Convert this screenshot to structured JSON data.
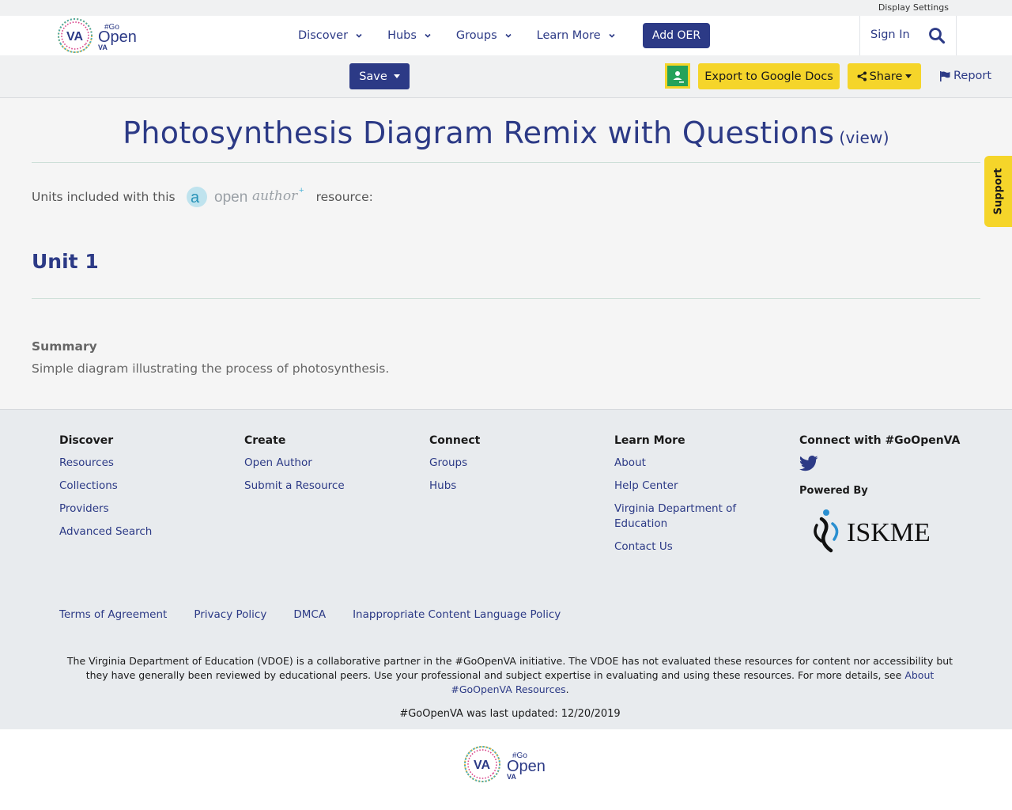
{
  "utility": {
    "display_settings": "Display Settings"
  },
  "header": {
    "logo_alt": "#GoOpenVA",
    "logo_text": {
      "va": "VA",
      "go": "#Go",
      "open": "Open",
      "va_small": "VA"
    },
    "nav": [
      {
        "label": "Discover"
      },
      {
        "label": "Hubs"
      },
      {
        "label": "Groups"
      },
      {
        "label": "Learn More"
      }
    ],
    "add_oer": "Add OER",
    "sign_in": "Sign In"
  },
  "toolbar": {
    "save": "Save",
    "export": "Export to Google Docs",
    "share": "Share",
    "report": "Report"
  },
  "main": {
    "title": "Photosynthesis Diagram Remix with Questions",
    "view_link": "(view)",
    "units_prefix": "Units included with this",
    "units_suffix": "resource:",
    "openauthor_logo": {
      "open": "open",
      "author": "author"
    },
    "unit_title": "Unit 1",
    "summary_heading": "Summary",
    "summary_text": "Simple diagram illustrating the process of photosynthesis."
  },
  "support_tab": "Support",
  "footer": {
    "columns": [
      {
        "heading": "Discover",
        "links": [
          "Resources",
          "Collections",
          "Providers",
          "Advanced Search"
        ]
      },
      {
        "heading": "Create",
        "links": [
          "Open Author",
          "Submit a Resource"
        ]
      },
      {
        "heading": "Connect",
        "links": [
          "Groups",
          "Hubs"
        ]
      },
      {
        "heading": "Learn More",
        "links": [
          "About",
          "Help Center",
          "Virginia Department of Education",
          "Contact Us"
        ]
      }
    ],
    "connect_heading": "Connect with #GoOpenVA",
    "powered_by": "Powered By",
    "iskme_text": "ISKME",
    "legal_links": [
      "Terms of Agreement",
      "Privacy Policy",
      "DMCA",
      "Inappropriate Content Language Policy"
    ],
    "disclaimer": "The Virginia Department of Education (VDOE) is a collaborative partner in the #GoOpenVA initiative. The VDOE has not evaluated these resources for content nor accessibility but they have generally been reviewed by educational peers. Use your professional and subject expertise in evaluating and using these resources. For more details, see",
    "disclaimer_link": "About #GoOpenVA Resources",
    "disclaimer_end": ".",
    "updated": "#GoOpenVA was last updated: 12/20/2019"
  },
  "colors": {
    "brand_navy": "#2c3a86",
    "accent_yellow": "#f5d52a",
    "classroom_green": "#25a25a"
  }
}
